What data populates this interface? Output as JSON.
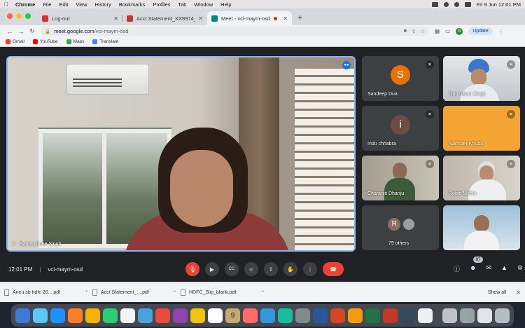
{
  "menubar": {
    "app": "Chrome",
    "items": [
      "File",
      "Edit",
      "View",
      "History",
      "Bookmarks",
      "Profiles",
      "Tab",
      "Window",
      "Help"
    ],
    "clock": "Fri 9 Jun  12:01 PM"
  },
  "tabs": [
    {
      "title": "Log-out",
      "color": "#d93025"
    },
    {
      "title": "Acct Statement_XX9974_0606",
      "color": "#c0392b"
    },
    {
      "title": "Meet - vci-maym-osd",
      "color": "#00897b"
    }
  ],
  "address": {
    "host": "meet.google.com",
    "path": "/vci-maym-osd",
    "update_label": "Update"
  },
  "bookmarks": [
    {
      "label": "Gmail",
      "color": "#ea4335"
    },
    {
      "label": "YouTube",
      "color": "#ff0000"
    },
    {
      "label": "Maps",
      "color": "#34a853"
    },
    {
      "label": "Translate",
      "color": "#4285f4"
    }
  ],
  "meet": {
    "main_name": "Bamanshree Singh",
    "participants": [
      {
        "name": "Sandeep Dua",
        "initial": "S",
        "avatar_color": "#e8710a",
        "tile_color": "#3c4043",
        "camera": false
      },
      {
        "name": "Gurcharan Singh",
        "initial": "",
        "avatar_color": "",
        "tile_color": "#cfd4d8",
        "camera": true
      },
      {
        "name": "Indu chhabra",
        "initial": "i",
        "avatar_color": "#6d4c41",
        "tile_color": "#3c4043",
        "camera": false
      },
      {
        "name": "Narinder Khuba",
        "initial": "",
        "avatar_color": "",
        "tile_color": "#f4a432",
        "camera": false
      },
      {
        "name": "Charanjit Dhanju",
        "initial": "",
        "avatar_color": "",
        "tile_color": "#b9b3a6",
        "camera": true
      },
      {
        "name": "Robin Mehta",
        "initial": "",
        "avatar_color": "",
        "tile_color": "#c7c2b7",
        "camera": true
      },
      {
        "name": "79 others",
        "initial": "R",
        "avatar_color": "#8d6e63",
        "tile_color": "#3c4043",
        "camera": false
      },
      {
        "name": "",
        "initial": "",
        "avatar_color": "",
        "tile_color": "#a8c4d8",
        "camera": true
      }
    ],
    "time": "12:01 PM",
    "code": "vci-maym-osd",
    "people_count": "87"
  },
  "downloads": {
    "files": [
      "Aneu sb hdfc 20....pdf",
      "Acct Statement_....pdf",
      "HDFC_Slip_blank.pdf"
    ],
    "show_all": "Show all"
  },
  "dock": {
    "calendar_day": "9",
    "icons": [
      "#3a7bd5",
      "#5ac8fa",
      "#1e90ff",
      "#ff7f27",
      "#f4b400",
      "#2ecc71",
      "#f5f5f5",
      "#4aa3df",
      "#e74c3c",
      "#8e44ad",
      "#f1c40f",
      "#ffffff",
      "#c8a96e",
      "#ff6b6b",
      "#3498db",
      "#1abc9c",
      "#7f8c8d",
      "#2b579a",
      "#d24726",
      "#f39c12",
      "#217346",
      "#c0392b",
      "#34495e",
      "#ecf0f1",
      "#bdc3c7",
      "#95a5a6",
      "#dfe6e9",
      "#b2bec3"
    ]
  }
}
